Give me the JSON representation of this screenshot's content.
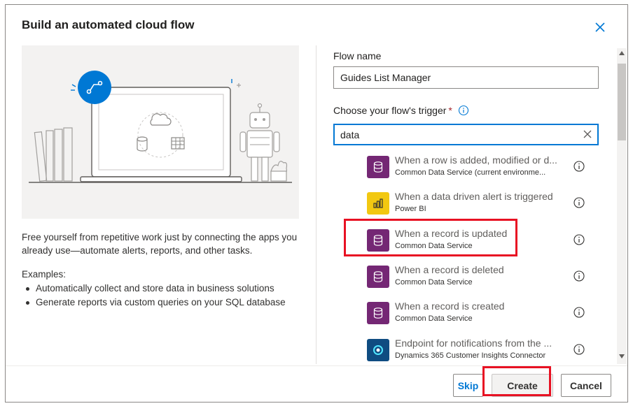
{
  "dialog": {
    "title": "Build an automated cloud flow"
  },
  "left": {
    "description": "Free yourself from repetitive work just by connecting the apps you already use—automate alerts, reports, and other tasks.",
    "examples_title": "Examples:",
    "examples": [
      "Automatically collect and store data in business solutions",
      "Generate reports via custom queries on your SQL database"
    ]
  },
  "form": {
    "flow_name_label": "Flow name",
    "flow_name_value": "Guides List Manager",
    "trigger_label": "Choose your flow's trigger",
    "required_marker": "*",
    "search_value": "data"
  },
  "triggers": [
    {
      "title": "When a row is added, modified or d...",
      "subtitle": "Common Data Service (current environme...",
      "icon": "database-icon",
      "color": "#742774"
    },
    {
      "title": "When a data driven alert is triggered",
      "subtitle": "Power BI",
      "icon": "power-bi-icon",
      "color": "#f2c811"
    },
    {
      "title": "When a record is updated",
      "subtitle": "Common Data Service",
      "icon": "database-icon",
      "color": "#742774"
    },
    {
      "title": "When a record is deleted",
      "subtitle": "Common Data Service",
      "icon": "database-icon",
      "color": "#742774"
    },
    {
      "title": "When a record is created",
      "subtitle": "Common Data Service",
      "icon": "database-icon",
      "color": "#742774"
    },
    {
      "title": "Endpoint for notifications from the ...",
      "subtitle": "Dynamics 365 Customer Insights Connector",
      "icon": "customer-insights-icon",
      "color": "#0f4c81"
    }
  ],
  "footer": {
    "skip_label": "Skip",
    "create_label": "Create",
    "cancel_label": "Cancel"
  },
  "colors": {
    "accent": "#0078d4",
    "highlight": "#e81123",
    "dataverse": "#742774",
    "powerbi": "#f2c811"
  }
}
